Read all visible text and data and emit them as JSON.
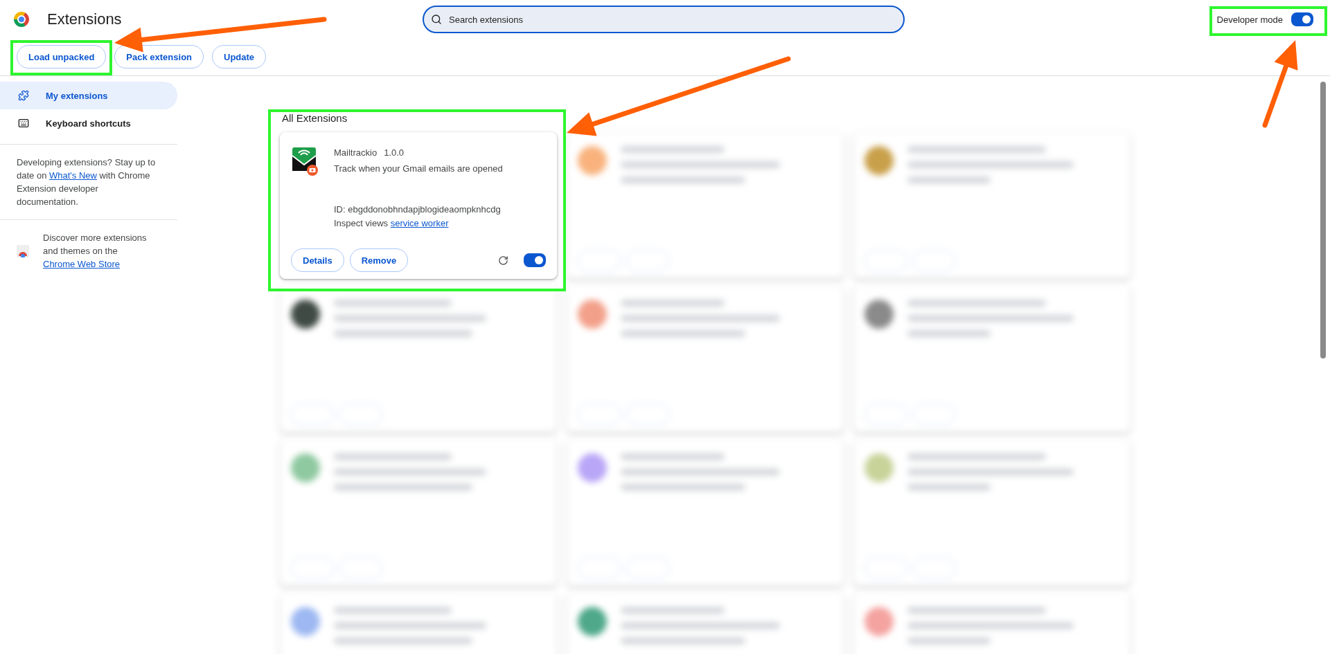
{
  "header": {
    "title": "Extensions",
    "search": {
      "placeholder": "Search extensions"
    },
    "developer_mode": {
      "label": "Developer mode",
      "on": true
    }
  },
  "toolbar": {
    "buttons": [
      "Load unpacked",
      "Pack extension",
      "Update"
    ]
  },
  "sidebar": {
    "items": [
      {
        "label": "My extensions",
        "selected": true
      },
      {
        "label": "Keyboard shortcuts",
        "selected": false
      }
    ],
    "developer_note": {
      "before": "Developing extensions? Stay up to date on ",
      "link": "What's New",
      "after": " with Chrome Extension developer documentation."
    },
    "store_note": {
      "text": "Discover more extensions and themes on the",
      "link": "Chrome Web Store"
    }
  },
  "section_title": "All Extensions",
  "extension": {
    "name": "Mailtrackio",
    "version": "1.0.0",
    "description": "Track when your Gmail emails are opened",
    "id": "ID: ebgddonobhndapjblogideaompknhcdg",
    "inspect_label": "Inspect views",
    "inspect_link": "service worker",
    "buttons": [
      "Details",
      "Remove"
    ],
    "enabled": true
  },
  "other_extensions": [
    {
      "color": "#f9b27c"
    },
    {
      "color": "#c9a04a"
    },
    {
      "color": "#3f4a44"
    },
    {
      "color": "#f3a08a"
    },
    {
      "color": "#8a8a8a"
    },
    {
      "color": "#8fc9a0"
    },
    {
      "color": "#b9a6f7"
    },
    {
      "color": "#c8d39a"
    },
    {
      "color": "#9db8f2"
    },
    {
      "color": "#4ea889"
    },
    {
      "color": "#f4a3a0"
    }
  ]
}
